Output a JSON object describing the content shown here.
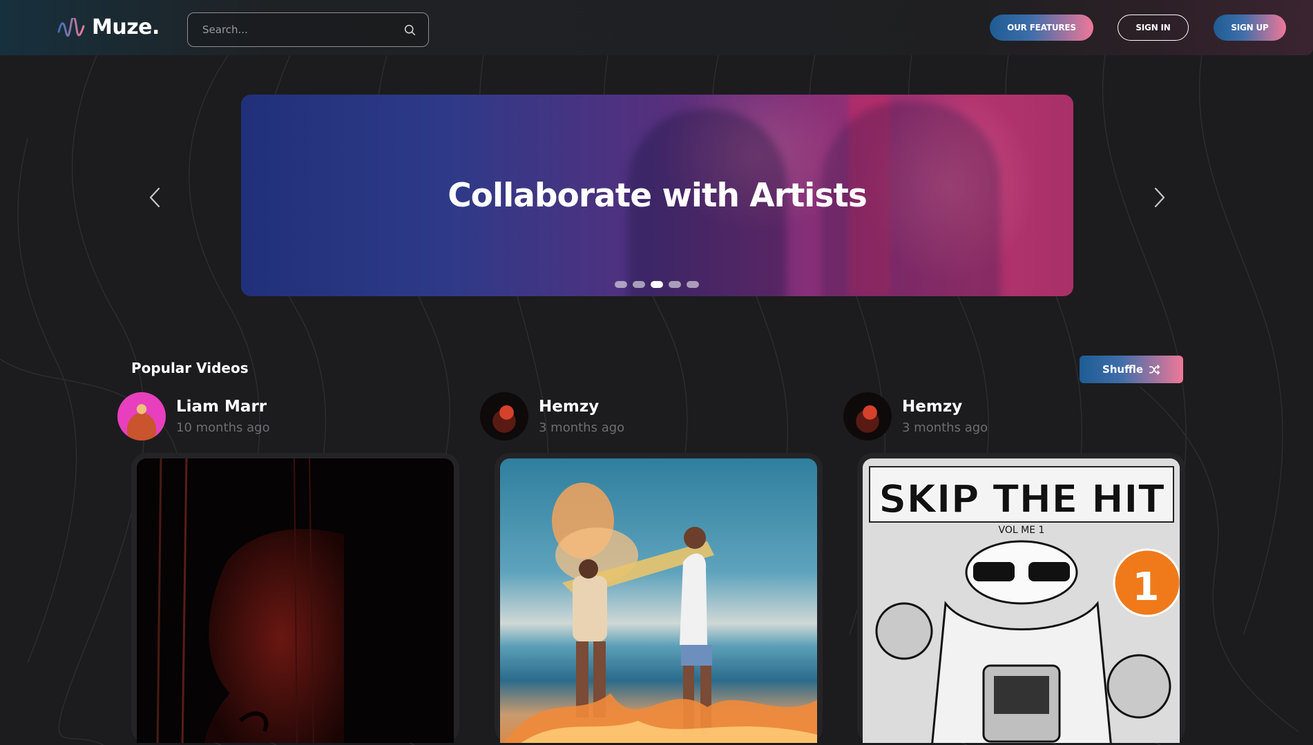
{
  "header": {
    "logo_text": "Muze.",
    "search_placeholder": "Search...",
    "features_label": "OUR FEATURES",
    "signin_label": "SIGN IN",
    "signup_label": "SIGN UP"
  },
  "carousel": {
    "title": "Collaborate with Artists",
    "slide_count": 5,
    "active_slide": 3
  },
  "section": {
    "title": "Popular Videos",
    "shuffle_label": "Shuffle"
  },
  "videos": [
    {
      "author": "Liam Marr",
      "time": "10 months ago"
    },
    {
      "author": "Hemzy",
      "time": "3 months ago"
    },
    {
      "author": "Hemzy",
      "time": "3 months ago"
    }
  ],
  "comic_cover": {
    "title": "SKIP THE HIT",
    "subtitle": "VOL ME 1",
    "badge": "1"
  },
  "colors": {
    "accent_blue": "#1e5c94",
    "accent_pink": "#f07898",
    "background": "#1c1c1e"
  }
}
